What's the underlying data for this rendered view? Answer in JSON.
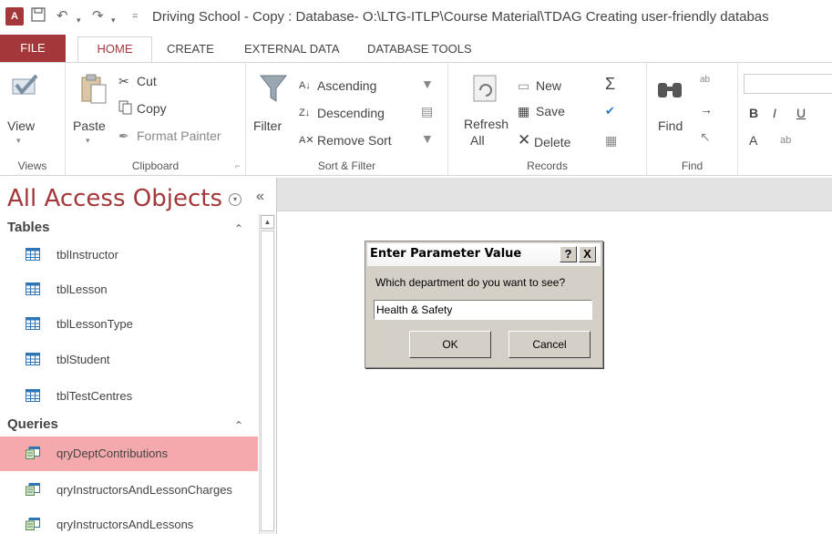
{
  "titlebar": {
    "app_icon_text": "A",
    "title": "Driving School - Copy : Database- O:\\LTG-ITLP\\Course Material\\TDAG Creating user-friendly databas"
  },
  "tabs": {
    "file": "FILE",
    "home": "HOME",
    "create": "CREATE",
    "external_data": "EXTERNAL DATA",
    "database_tools": "DATABASE TOOLS"
  },
  "ribbon": {
    "views": {
      "label": "Views",
      "view": "View"
    },
    "clipboard": {
      "label": "Clipboard",
      "paste": "Paste",
      "cut": "Cut",
      "copy": "Copy",
      "format_painter": "Format Painter"
    },
    "sort_filter": {
      "label": "Sort & Filter",
      "filter": "Filter",
      "ascending": "Ascending",
      "descending": "Descending",
      "remove_sort": "Remove Sort"
    },
    "records": {
      "label": "Records",
      "refresh": "Refresh",
      "refresh_all": "All",
      "new": "New",
      "save": "Save",
      "delete": "Delete"
    },
    "find": {
      "label": "Find",
      "find": "Find"
    },
    "text_formatting": {
      "bold": "B",
      "italic": "I",
      "underline": "U",
      "font_color": "A"
    }
  },
  "nav": {
    "title": "All Access Objects",
    "collapse": "«",
    "tables_header": "Tables",
    "tables": [
      "tblInstructor",
      "tblLesson",
      "tblLessonType",
      "tblStudent",
      "tblTestCentres"
    ],
    "queries_header": "Queries",
    "queries": [
      "qryDeptContributions",
      "qryInstructorsAndLessonCharges",
      "qryInstructorsAndLessons"
    ],
    "selected": "qryDeptContributions"
  },
  "dialog": {
    "title": "Enter Parameter Value",
    "help_btn": "?",
    "close_btn": "X",
    "prompt": "Which department do you want to see?",
    "value": "Health & Safety",
    "ok": "OK",
    "cancel": "Cancel"
  },
  "colors": {
    "accent": "#a4373a",
    "selected_row": "#f4a9ac",
    "dialog_face": "#d4d0c8"
  }
}
